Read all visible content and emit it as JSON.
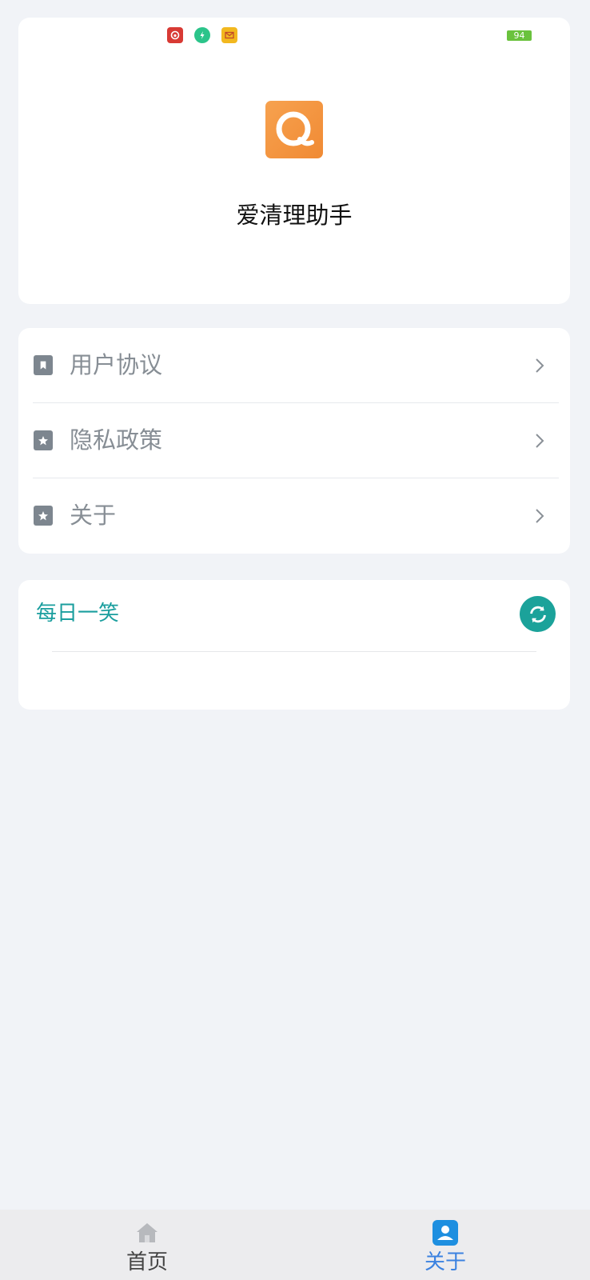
{
  "status_bar": {
    "icons": [
      "netease-music-icon",
      "shield-bolt-icon",
      "mail-icon"
    ],
    "battery": "94"
  },
  "app": {
    "name": "爱清理助手",
    "logo_color": "#f39240"
  },
  "menu": {
    "items": [
      {
        "label": "用户协议",
        "icon": "bookmark-icon"
      },
      {
        "label": "隐私政策",
        "icon": "star-icon"
      },
      {
        "label": "关于",
        "icon": "star-icon"
      }
    ]
  },
  "joke": {
    "title": "每日一笑",
    "accent": "#1ba29a"
  },
  "tabbar": {
    "tabs": [
      {
        "label": "首页",
        "icon": "home-icon",
        "active": false
      },
      {
        "label": "关于",
        "icon": "profile-icon",
        "active": true
      }
    ],
    "active_color": "#3b82e0",
    "inactive_color": "#444444"
  }
}
